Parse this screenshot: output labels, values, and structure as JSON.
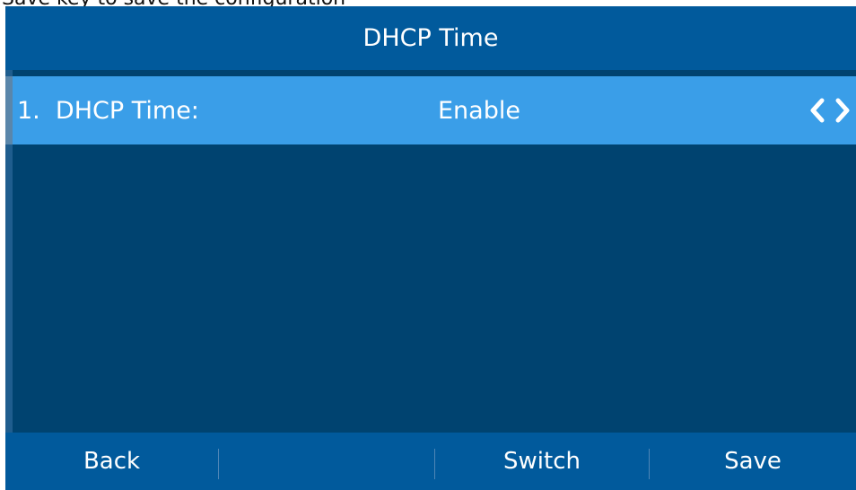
{
  "caption": "Save key to save the configuration",
  "title": "DHCP Time",
  "row": {
    "label": "1.  DHCP Time:",
    "value": "Enable",
    "icons": [
      "chevron-left-icon",
      "chevron-right-icon"
    ]
  },
  "softkeys": {
    "back": "Back",
    "empty": "",
    "switch": "Switch",
    "save": "Save"
  },
  "colors": {
    "screen_bg": "#004370",
    "bar_bg": "#015a9c",
    "selection": "#3a9ee8"
  }
}
